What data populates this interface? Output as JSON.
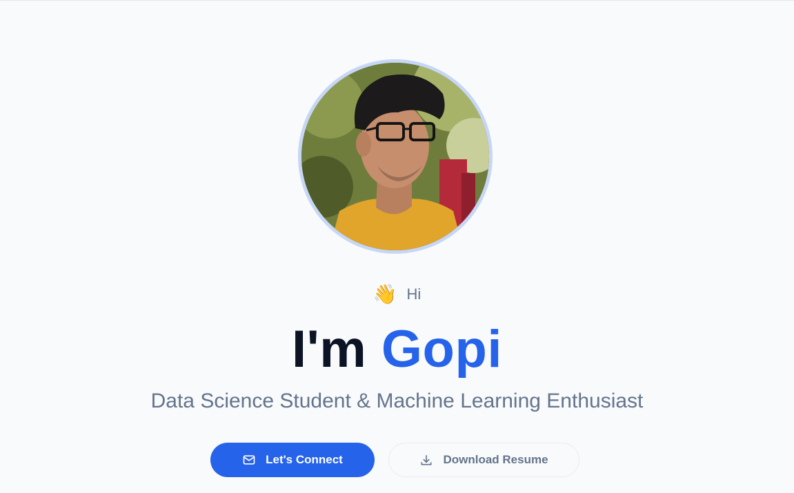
{
  "hero": {
    "greeting_icon": "waving-hand-icon",
    "greeting_emoji": "👋",
    "greeting_text": "Hi",
    "title_prefix": "I'm ",
    "title_name": "Gopi",
    "subtitle": "Data Science Student & Machine Learning Enthusiast"
  },
  "buttons": {
    "connect": {
      "label": "Let's Connect",
      "icon": "mail-icon"
    },
    "resume": {
      "label": "Download Resume",
      "icon": "download-icon"
    }
  },
  "colors": {
    "accent": "#2563eb",
    "background": "#f8fafc",
    "heading": "#0b1324",
    "muted": "#64748b"
  }
}
